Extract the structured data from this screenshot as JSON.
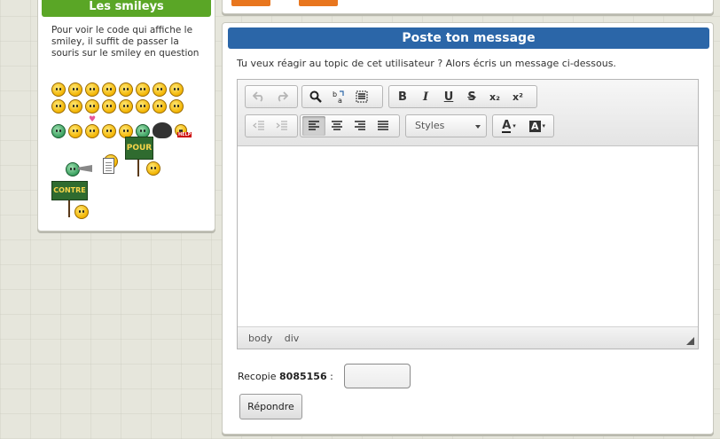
{
  "smileys": {
    "title": "Les smileys",
    "help_text": "Pour voir le code qui affiche le smiley, il suffit de passer la souris sur le smiley en question",
    "sign_pour": "POUR",
    "sign_contre": "CONTRE",
    "help_tag": "HELP"
  },
  "post": {
    "title": "Poste ton message",
    "intro": "Tu veux réagir au topic de cet utilisateur ? Alors écris un message ci-dessous.",
    "styles_label": "Styles",
    "status_path": [
      "body",
      "div"
    ],
    "captcha_prefix": "Recopie",
    "captcha_code": "8085156",
    "captcha_suffix": ":",
    "captcha_value": "",
    "reply_label": "Répondre"
  },
  "toolbar_icons": {
    "undo": "undo-icon",
    "redo": "redo-icon",
    "find": "search-icon",
    "replace": "replace-icon",
    "select_all": "select-all-icon",
    "bold": "B",
    "italic": "I",
    "underline": "U",
    "strike": "S",
    "subscript": "x₂",
    "superscript": "x²",
    "text_color": "A",
    "bg_color": "A"
  },
  "colors": {
    "smileys_header": "#5aa626",
    "post_header": "#2b66a8",
    "orange_tab": "#e8761e"
  }
}
